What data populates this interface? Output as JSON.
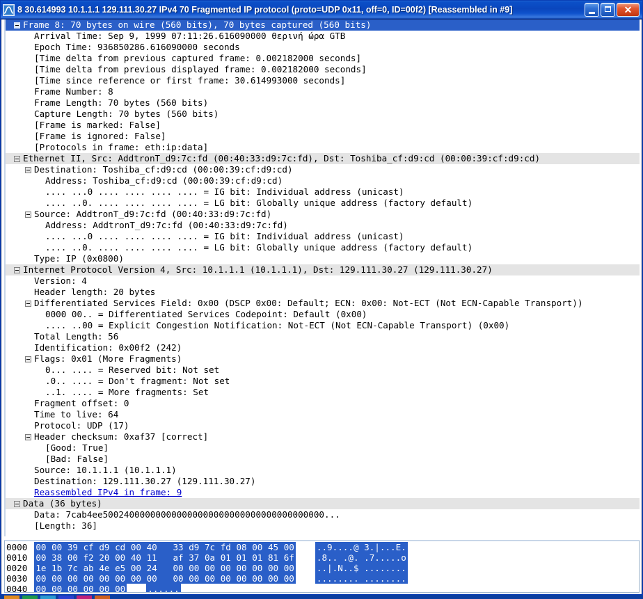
{
  "window": {
    "icon": "wireshark-icon",
    "title": "8 30.614993 10.1.1.1 129.111.30.27 IPv4 70 Fragmented IP protocol (proto=UDP 0x11, off=0, ID=00f2) [Reassembled in #9]",
    "minimize_label": "",
    "maximize_label": "",
    "close_label": "✕",
    "titlebar_color": "#0a46bd",
    "selection_color": "#2a5fc8",
    "protocol_row_color": "#e4e4e4",
    "link_color": "#0000cc"
  },
  "detail_tree": [
    {
      "indent": 0,
      "expander": "minus",
      "selected": true,
      "proto": false,
      "text": "Frame 8: 70 bytes on wire (560 bits), 70 bytes captured (560 bits)"
    },
    {
      "indent": 1,
      "expander": "none",
      "selected": false,
      "proto": false,
      "text": "Arrival Time: Sep  9, 1999 07:11:26.616090000 θερινή ώρα GTB"
    },
    {
      "indent": 1,
      "expander": "none",
      "selected": false,
      "proto": false,
      "text": "Epoch Time: 936850286.616090000 seconds"
    },
    {
      "indent": 1,
      "expander": "none",
      "selected": false,
      "proto": false,
      "text": "[Time delta from previous captured frame: 0.002182000 seconds]"
    },
    {
      "indent": 1,
      "expander": "none",
      "selected": false,
      "proto": false,
      "text": "[Time delta from previous displayed frame: 0.002182000 seconds]"
    },
    {
      "indent": 1,
      "expander": "none",
      "selected": false,
      "proto": false,
      "text": "[Time since reference or first frame: 30.614993000 seconds]"
    },
    {
      "indent": 1,
      "expander": "none",
      "selected": false,
      "proto": false,
      "text": "Frame Number: 8"
    },
    {
      "indent": 1,
      "expander": "none",
      "selected": false,
      "proto": false,
      "text": "Frame Length: 70 bytes (560 bits)"
    },
    {
      "indent": 1,
      "expander": "none",
      "selected": false,
      "proto": false,
      "text": "Capture Length: 70 bytes (560 bits)"
    },
    {
      "indent": 1,
      "expander": "none",
      "selected": false,
      "proto": false,
      "text": "[Frame is marked: False]"
    },
    {
      "indent": 1,
      "expander": "none",
      "selected": false,
      "proto": false,
      "text": "[Frame is ignored: False]"
    },
    {
      "indent": 1,
      "expander": "none",
      "selected": false,
      "proto": false,
      "text": "[Protocols in frame: eth:ip:data]"
    },
    {
      "indent": 0,
      "expander": "minus",
      "selected": false,
      "proto": true,
      "text": "Ethernet II, Src: AddtronT_d9:7c:fd (00:40:33:d9:7c:fd), Dst: Toshiba_cf:d9:cd (00:00:39:cf:d9:cd)"
    },
    {
      "indent": 1,
      "expander": "minus",
      "selected": false,
      "proto": false,
      "text": "Destination: Toshiba_cf:d9:cd (00:00:39:cf:d9:cd)"
    },
    {
      "indent": 2,
      "expander": "none",
      "selected": false,
      "proto": false,
      "text": "Address: Toshiba_cf:d9:cd (00:00:39:cf:d9:cd)"
    },
    {
      "indent": 2,
      "expander": "none",
      "selected": false,
      "proto": false,
      "text": ".... ...0 .... .... .... .... = IG bit: Individual address (unicast)"
    },
    {
      "indent": 2,
      "expander": "none",
      "selected": false,
      "proto": false,
      "text": ".... ..0. .... .... .... .... = LG bit: Globally unique address (factory default)"
    },
    {
      "indent": 1,
      "expander": "minus",
      "selected": false,
      "proto": false,
      "text": "Source: AddtronT_d9:7c:fd (00:40:33:d9:7c:fd)"
    },
    {
      "indent": 2,
      "expander": "none",
      "selected": false,
      "proto": false,
      "text": "Address: AddtronT_d9:7c:fd (00:40:33:d9:7c:fd)"
    },
    {
      "indent": 2,
      "expander": "none",
      "selected": false,
      "proto": false,
      "text": ".... ...0 .... .... .... .... = IG bit: Individual address (unicast)"
    },
    {
      "indent": 2,
      "expander": "none",
      "selected": false,
      "proto": false,
      "text": ".... ..0. .... .... .... .... = LG bit: Globally unique address (factory default)"
    },
    {
      "indent": 1,
      "expander": "none",
      "selected": false,
      "proto": false,
      "text": "Type: IP (0x0800)"
    },
    {
      "indent": 0,
      "expander": "minus",
      "selected": false,
      "proto": true,
      "text": "Internet Protocol Version 4, Src: 10.1.1.1 (10.1.1.1), Dst: 129.111.30.27 (129.111.30.27)"
    },
    {
      "indent": 1,
      "expander": "none",
      "selected": false,
      "proto": false,
      "text": "Version: 4"
    },
    {
      "indent": 1,
      "expander": "none",
      "selected": false,
      "proto": false,
      "text": "Header length: 20 bytes"
    },
    {
      "indent": 1,
      "expander": "minus",
      "selected": false,
      "proto": false,
      "text": "Differentiated Services Field: 0x00 (DSCP 0x00: Default; ECN: 0x00: Not-ECT (Not ECN-Capable Transport))"
    },
    {
      "indent": 2,
      "expander": "none",
      "selected": false,
      "proto": false,
      "text": "0000 00.. = Differentiated Services Codepoint: Default (0x00)"
    },
    {
      "indent": 2,
      "expander": "none",
      "selected": false,
      "proto": false,
      "text": ".... ..00 = Explicit Congestion Notification: Not-ECT (Not ECN-Capable Transport) (0x00)"
    },
    {
      "indent": 1,
      "expander": "none",
      "selected": false,
      "proto": false,
      "text": "Total Length: 56"
    },
    {
      "indent": 1,
      "expander": "none",
      "selected": false,
      "proto": false,
      "text": "Identification: 0x00f2 (242)"
    },
    {
      "indent": 1,
      "expander": "minus",
      "selected": false,
      "proto": false,
      "text": "Flags: 0x01 (More Fragments)"
    },
    {
      "indent": 2,
      "expander": "none",
      "selected": false,
      "proto": false,
      "text": "0... .... = Reserved bit: Not set"
    },
    {
      "indent": 2,
      "expander": "none",
      "selected": false,
      "proto": false,
      "text": ".0.. .... = Don't fragment: Not set"
    },
    {
      "indent": 2,
      "expander": "none",
      "selected": false,
      "proto": false,
      "text": "..1. .... = More fragments: Set"
    },
    {
      "indent": 1,
      "expander": "none",
      "selected": false,
      "proto": false,
      "text": "Fragment offset: 0"
    },
    {
      "indent": 1,
      "expander": "none",
      "selected": false,
      "proto": false,
      "text": "Time to live: 64"
    },
    {
      "indent": 1,
      "expander": "none",
      "selected": false,
      "proto": false,
      "text": "Protocol: UDP (17)"
    },
    {
      "indent": 1,
      "expander": "minus",
      "selected": false,
      "proto": false,
      "text": "Header checksum: 0xaf37 [correct]"
    },
    {
      "indent": 2,
      "expander": "none",
      "selected": false,
      "proto": false,
      "text": "[Good: True]"
    },
    {
      "indent": 2,
      "expander": "none",
      "selected": false,
      "proto": false,
      "text": "[Bad: False]"
    },
    {
      "indent": 1,
      "expander": "none",
      "selected": false,
      "proto": false,
      "text": "Source: 10.1.1.1 (10.1.1.1)"
    },
    {
      "indent": 1,
      "expander": "none",
      "selected": false,
      "proto": false,
      "text": "Destination: 129.111.30.27 (129.111.30.27)"
    },
    {
      "indent": 1,
      "expander": "none",
      "selected": false,
      "proto": false,
      "link": true,
      "text": "Reassembled IPv4 in frame: 9"
    },
    {
      "indent": 0,
      "expander": "minus",
      "selected": false,
      "proto": true,
      "text": "Data (36 bytes)"
    },
    {
      "indent": 1,
      "expander": "none",
      "selected": false,
      "proto": false,
      "text": "Data: 7cab4ee500240000000000000000000000000000000000000..."
    },
    {
      "indent": 1,
      "expander": "none",
      "selected": false,
      "proto": false,
      "text": "[Length: 36]"
    }
  ],
  "hex_dump": [
    {
      "offset": "0000",
      "bytes": "00 00 39 cf d9 cd 00 40   33 d9 7c fd 08 00 45 00",
      "ascii": "..9....@ 3.|...E."
    },
    {
      "offset": "0010",
      "bytes": "00 38 00 f2 20 00 40 11   af 37 0a 01 01 01 81 6f",
      "ascii": ".8.. .@. .7.....o"
    },
    {
      "offset": "0020",
      "bytes": "1e 1b 7c ab 4e e5 00 24   00 00 00 00 00 00 00 00",
      "ascii": "..|.N..$ ........"
    },
    {
      "offset": "0030",
      "bytes": "00 00 00 00 00 00 00 00   00 00 00 00 00 00 00 00",
      "ascii": "........ ........"
    },
    {
      "offset": "0040",
      "bytes": "00 00 00 00 00 00",
      "ascii": "......"
    }
  ],
  "taskbar_swatches": [
    "#e08a1e",
    "#1e9a4a",
    "#2a9ad0",
    "#2a3fd0",
    "#c0207a",
    "#d0601e"
  ]
}
